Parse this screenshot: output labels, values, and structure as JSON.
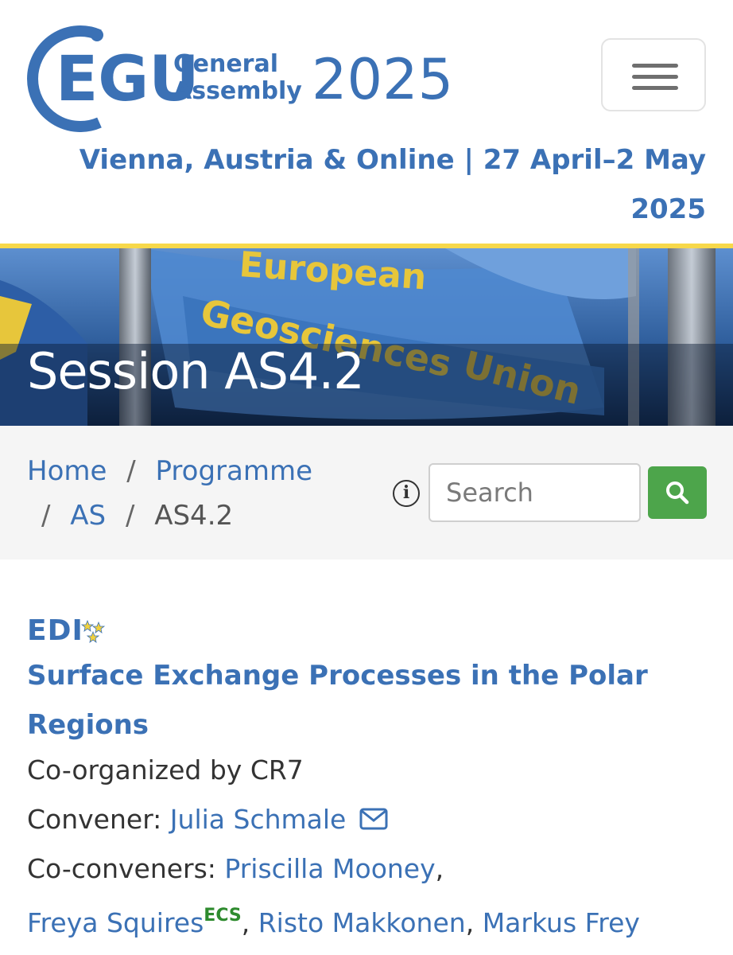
{
  "header": {
    "logo_text": "EGU",
    "logo_line1": "General",
    "logo_line2": "Assembly",
    "year": "2025",
    "venue_line1": "Vienna, Austria & Online | 27 April–2 May",
    "venue_line2": "2025",
    "menu_icon": "hamburger-menu-icon"
  },
  "banner": {
    "title": "Session AS4.2",
    "flag_text_1": "European",
    "flag_text_2": "Geosciences",
    "flag_text_3": "Union"
  },
  "breadcrumb": {
    "home": "Home",
    "programme": "Programme",
    "division": "AS",
    "current": "AS4.2",
    "separator": "/"
  },
  "search": {
    "info_icon": "i",
    "placeholder": "Search",
    "button_icon": "search-icon"
  },
  "session": {
    "badge": "EDI",
    "title_line1": "Surface Exchange Processes in the Polar",
    "title_line2": "Regions",
    "co_organized": "Co-organized by CR7",
    "convener_label": "Convener:",
    "convener_name": "Julia Schmale",
    "coconveners_label": "Co-conveners:",
    "coconvener_1": "Priscilla Mooney",
    "coconvener_2": "Freya Squires",
    "coconvener_2_badge": "ECS",
    "coconvener_3": "Risto Makkonen",
    "coconvener_4": "Markus Frey",
    "comma": ","
  },
  "colors": {
    "brand_blue": "#3b71b5",
    "accent_yellow": "#f7d84a",
    "search_green": "#4da54b",
    "ecs_green": "#2e8b2e"
  }
}
